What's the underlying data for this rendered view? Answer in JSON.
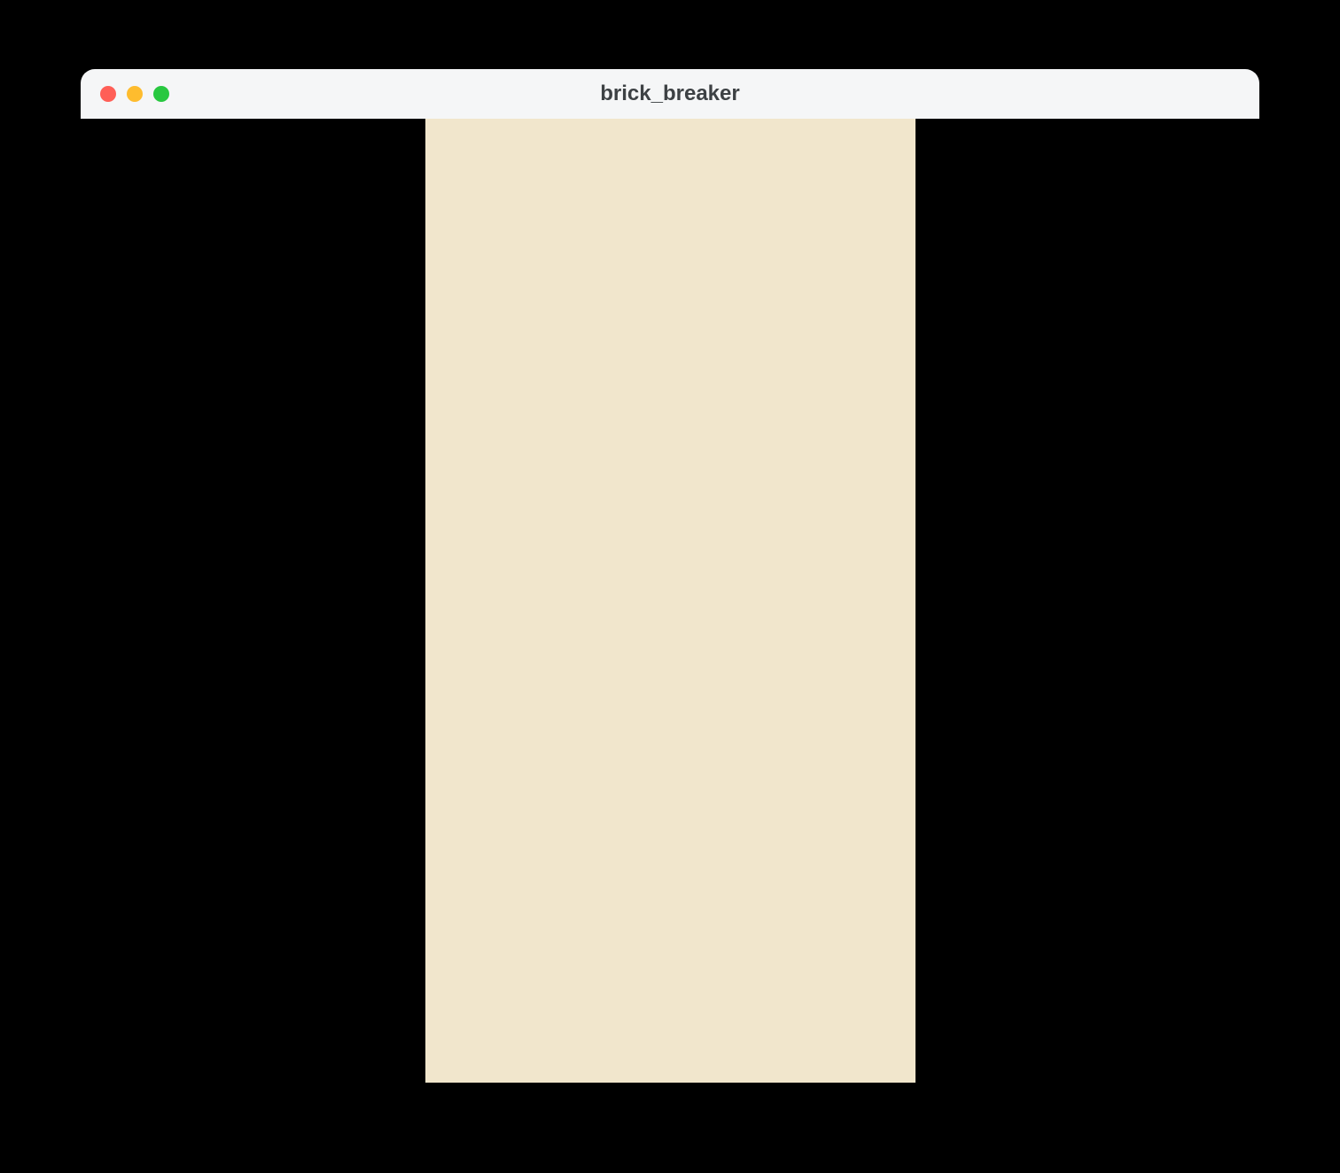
{
  "window": {
    "title": "brick_breaker"
  },
  "colors": {
    "titlebar_bg": "#f5f6f7",
    "title_text": "#3d4144",
    "close_button": "#ff5f57",
    "minimize_button": "#febc2e",
    "zoom_button": "#28c840",
    "page_bg": "#000000",
    "canvas_bg": "#f1e6cc"
  }
}
